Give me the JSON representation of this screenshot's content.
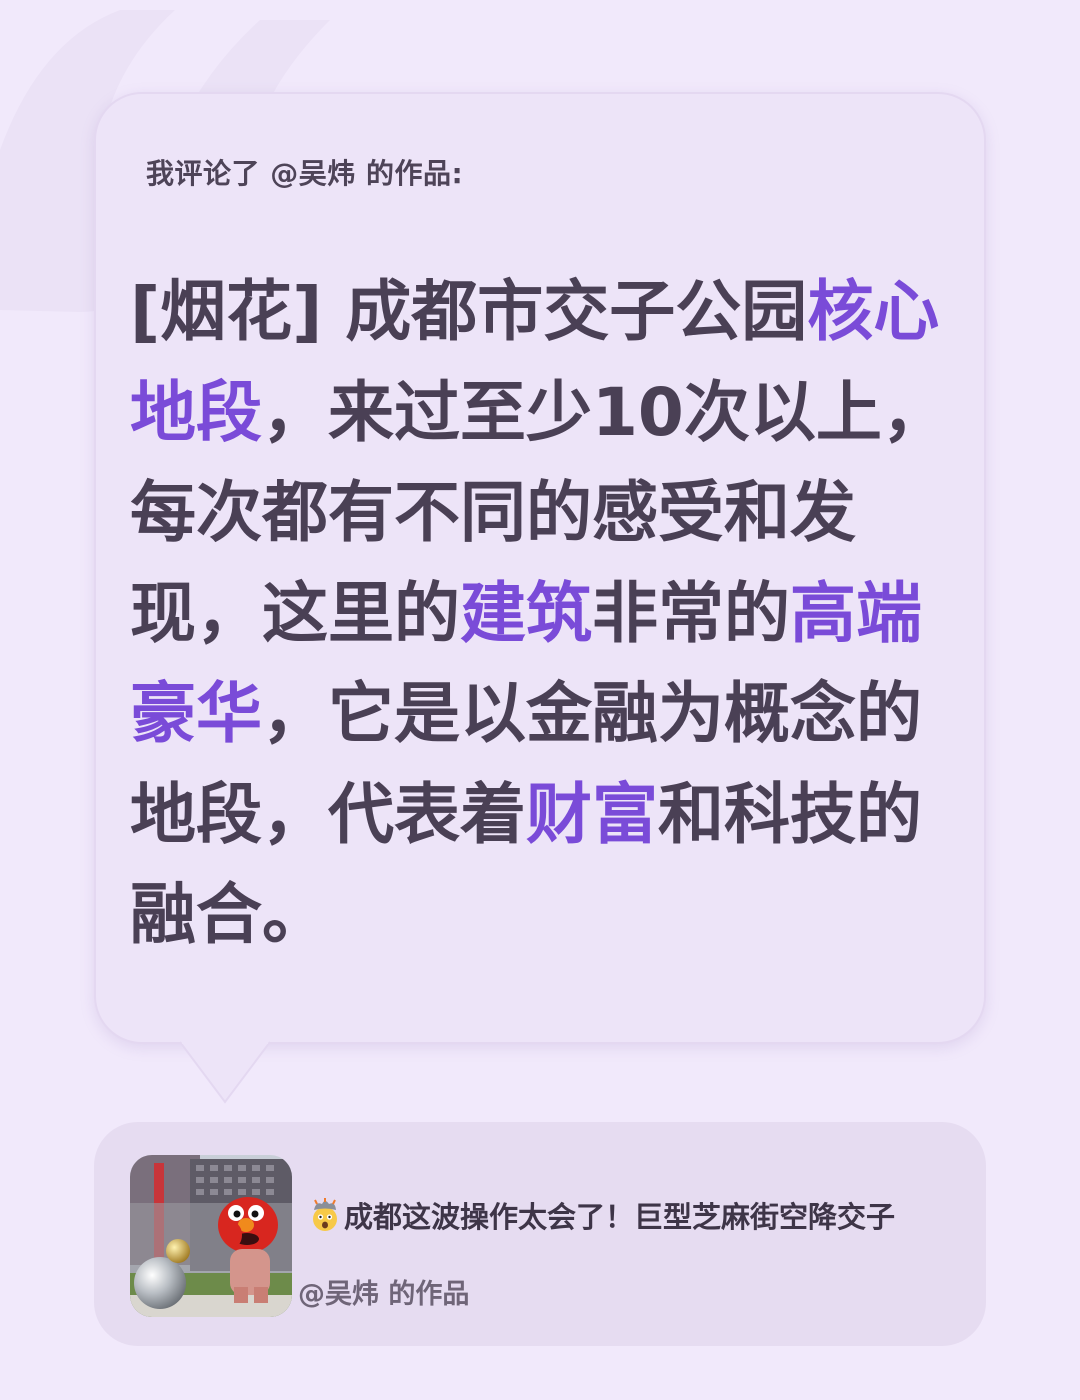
{
  "comment": {
    "header": "我评论了 @吴炜 的作品:",
    "body_segments": [
      {
        "text": "[烟花] 成都市交子公园",
        "highlight": false
      },
      {
        "text": "核心地段",
        "highlight": true
      },
      {
        "text": "，来过至少10次以上，每次都有不同的感受和发现，这里的",
        "highlight": false
      },
      {
        "text": "建筑",
        "highlight": true
      },
      {
        "text": "非常的",
        "highlight": false
      },
      {
        "text": "高端豪华",
        "highlight": true
      },
      {
        "text": "，它是以金融为概念的地段，代表着",
        "highlight": false
      },
      {
        "text": "财富",
        "highlight": true
      },
      {
        "text": "和科技的融合。",
        "highlight": false
      }
    ]
  },
  "work_card": {
    "title_emoji": "exploding-head-icon",
    "title": "成都这波操作太会了！巨型芝麻街空降交子",
    "author": "@吴炜 的作品",
    "thumbnail_icon": "elmo-sculpture-photo"
  },
  "colors": {
    "background": "#f1e9fb",
    "bubble": "#ede4f8",
    "text": "#4a4055",
    "highlight": "#7a4bd8",
    "card": "#e6dcf1"
  }
}
